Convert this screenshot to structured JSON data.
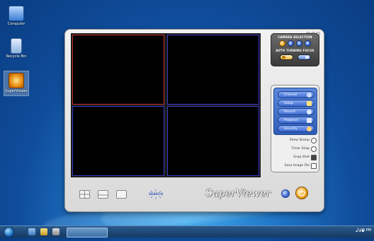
{
  "desktop": {
    "icons": [
      {
        "label": "Computer",
        "icon": "computer-icon"
      },
      {
        "label": "Recycle Bin",
        "icon": "recycle-bin-icon"
      },
      {
        "label": "SuperViewer",
        "icon": "superviewer-app-icon"
      }
    ]
  },
  "taskbar": {
    "clock": "7:09 PM",
    "tray_icons": [
      "network-icon",
      "volume-icon",
      "flag-icon"
    ]
  },
  "app": {
    "brand": "SuperViewer",
    "camera_selection": {
      "title": "CAMERA SELECTION",
      "cameras": [
        "1",
        "2",
        "3",
        "4"
      ],
      "active_camera": "1"
    },
    "auto_focus": {
      "title": "AUTO TURNING FOCUS",
      "toggles": [
        "on",
        "off"
      ]
    },
    "menu": [
      "Channel",
      "Setup",
      "Record",
      "Playback",
      "Security"
    ],
    "shortcuts": [
      "Show Stamp",
      "Timer Snap",
      "Snap Shot",
      "Save Image File"
    ],
    "layout_options": [
      "quad-view-icon",
      "split-view-icon",
      "single-view-icon"
    ],
    "search_label": "SEARCH"
  },
  "colors": {
    "desktop_blue": "#1f74c6",
    "selected_cell_border": "#c23030",
    "cell_border": "#3b3bc9",
    "menu_blue": "#3c6ad0",
    "camera_active": "#f0a31a"
  }
}
